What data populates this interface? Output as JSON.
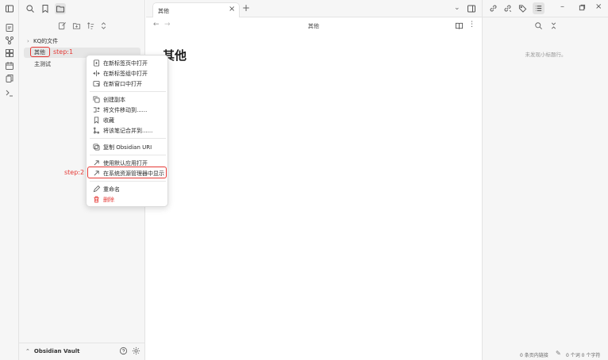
{
  "sidebar": {
    "tree": {
      "folder_label": "KQ的文件",
      "selected_item": "其他",
      "other_item": "主测试"
    },
    "vault_name": "Obsidian Vault"
  },
  "tabs": [
    {
      "label": "其他"
    }
  ],
  "editor": {
    "breadcrumb_title": "其他",
    "heading": "其他"
  },
  "right_panel": {
    "empty_text": "未发现小标题行。"
  },
  "status_bar": {
    "backlinks": "0 条页内链接",
    "counts": "0 个词  0 个字符"
  },
  "context_menu": {
    "items": [
      {
        "label": "在新标签页中打开",
        "icon": "new-tab-icon"
      },
      {
        "label": "在新标签组中打开",
        "icon": "split-icon"
      },
      {
        "label": "在新窗口中打开",
        "icon": "new-window-icon"
      },
      {
        "label": "创建副本",
        "icon": "copy-icon"
      },
      {
        "label": "将文件移动到......",
        "icon": "move-icon"
      },
      {
        "label": "收藏",
        "icon": "bookmark-icon"
      },
      {
        "label": "将该笔记合并到......",
        "icon": "merge-icon"
      },
      {
        "label": "复制 Obsidian URI",
        "icon": "link-icon"
      },
      {
        "label": "使用默认应用打开",
        "icon": "external-icon"
      },
      {
        "label": "在系统资源管理器中显示",
        "icon": "reveal-icon"
      },
      {
        "label": "重命名",
        "icon": "pencil-icon"
      },
      {
        "label": "删除",
        "icon": "trash-icon"
      }
    ]
  },
  "annotations": {
    "step1": "step:1",
    "step2": "step:2"
  },
  "colors": {
    "annotation_red": "#e53935",
    "danger": "#e53935"
  }
}
